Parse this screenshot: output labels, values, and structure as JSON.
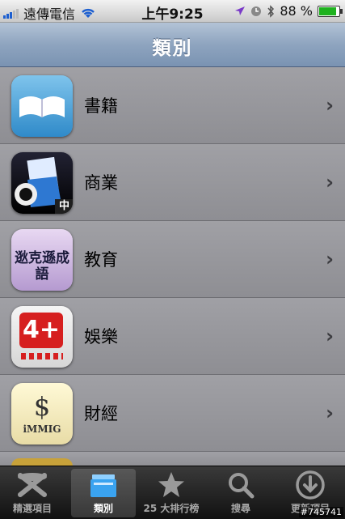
{
  "status": {
    "carrier": "遠傳電信",
    "time": "上午9:25",
    "battery": "88 %",
    "battery_level": 0.88
  },
  "nav": {
    "title": "類別"
  },
  "categories": [
    {
      "label": "書籍",
      "icon": "book-icon"
    },
    {
      "label": "商業",
      "icon": "business-icon",
      "badge": "中"
    },
    {
      "label": "教育",
      "icon": "education-icon",
      "icon_text": "逖克遜成語"
    },
    {
      "label": "娛樂",
      "icon": "entertainment-icon",
      "icon_text": "4+"
    },
    {
      "label": "財經",
      "icon": "finance-icon",
      "icon_text": "iMMIG"
    }
  ],
  "tabs": [
    {
      "label": "精選項目",
      "icon": "featured-icon"
    },
    {
      "label": "類別",
      "icon": "categories-icon",
      "selected": true
    },
    {
      "label": "25 大排行榜",
      "icon": "star-icon"
    },
    {
      "label": "搜尋",
      "icon": "search-icon"
    },
    {
      "label": "更新項目",
      "icon": "download-icon"
    }
  ],
  "watermark": "#745741",
  "colors": {
    "nav": "#8ea4bf",
    "list_bg": "#8e8e93",
    "tabbar": "#1a1a1a"
  }
}
